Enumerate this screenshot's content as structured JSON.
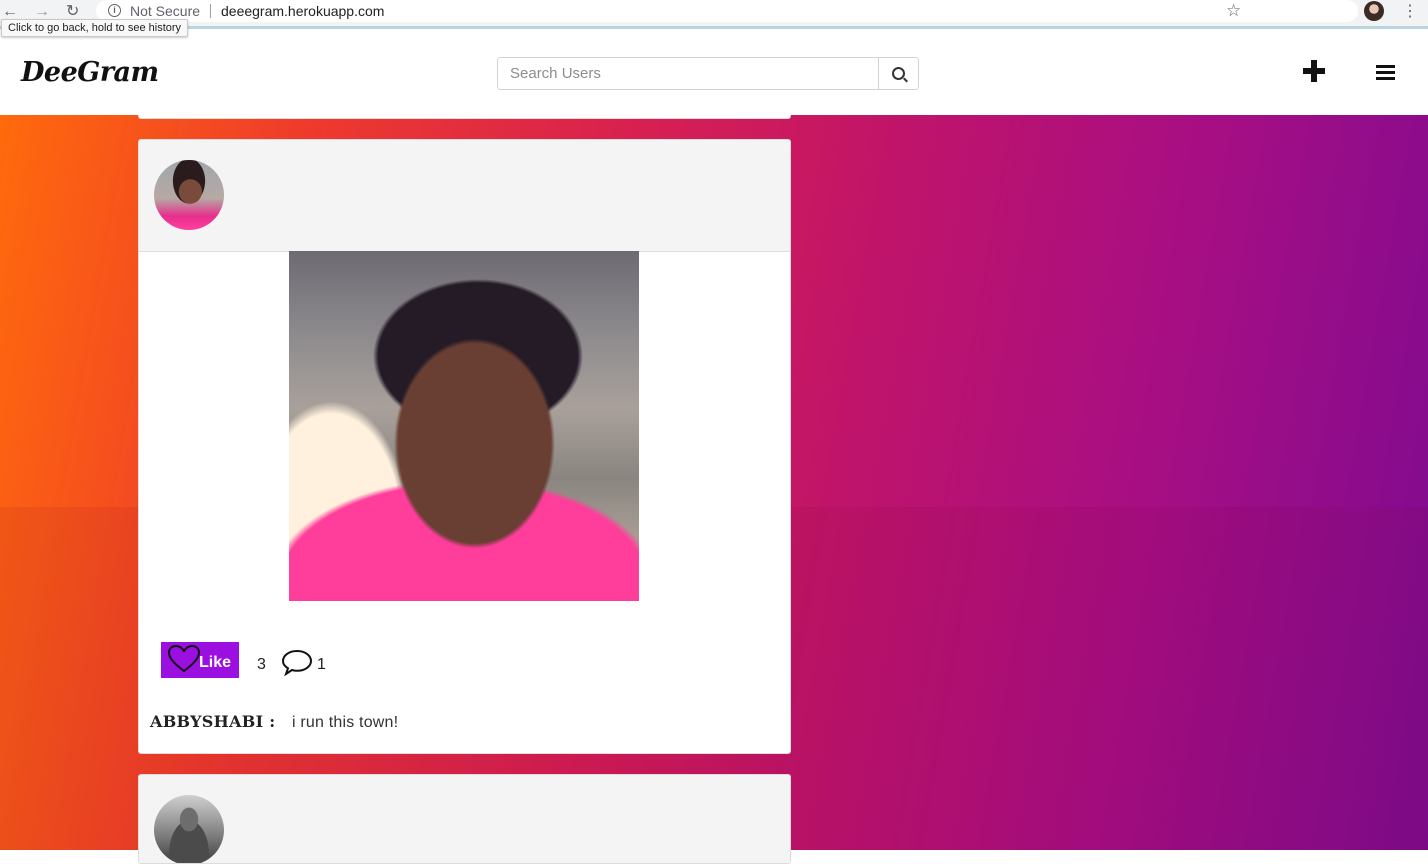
{
  "browser": {
    "back_icon": "arrow-left-icon",
    "forward_icon": "arrow-right-icon",
    "reload_icon": "reload-icon",
    "security_label": "Not Secure",
    "url": "deeegram.herokuapp.com",
    "tooltip": "Click to go back, hold to see history"
  },
  "header": {
    "brand": "DeeGram",
    "search_placeholder": "Search Users",
    "search_value": "",
    "icons": [
      "search-icon",
      "plus-icon",
      "hamburger-menu-icon"
    ]
  },
  "theme": {
    "accent": "#9b0fe0",
    "background_gradient": [
      "#ff6a0c",
      "#d61f52",
      "#7d0b90"
    ]
  },
  "posts": [
    {
      "username": "ABBYSHABI :",
      "caption": "i run this town!",
      "like_label": "Like",
      "likes": "3",
      "comments": "1"
    }
  ]
}
